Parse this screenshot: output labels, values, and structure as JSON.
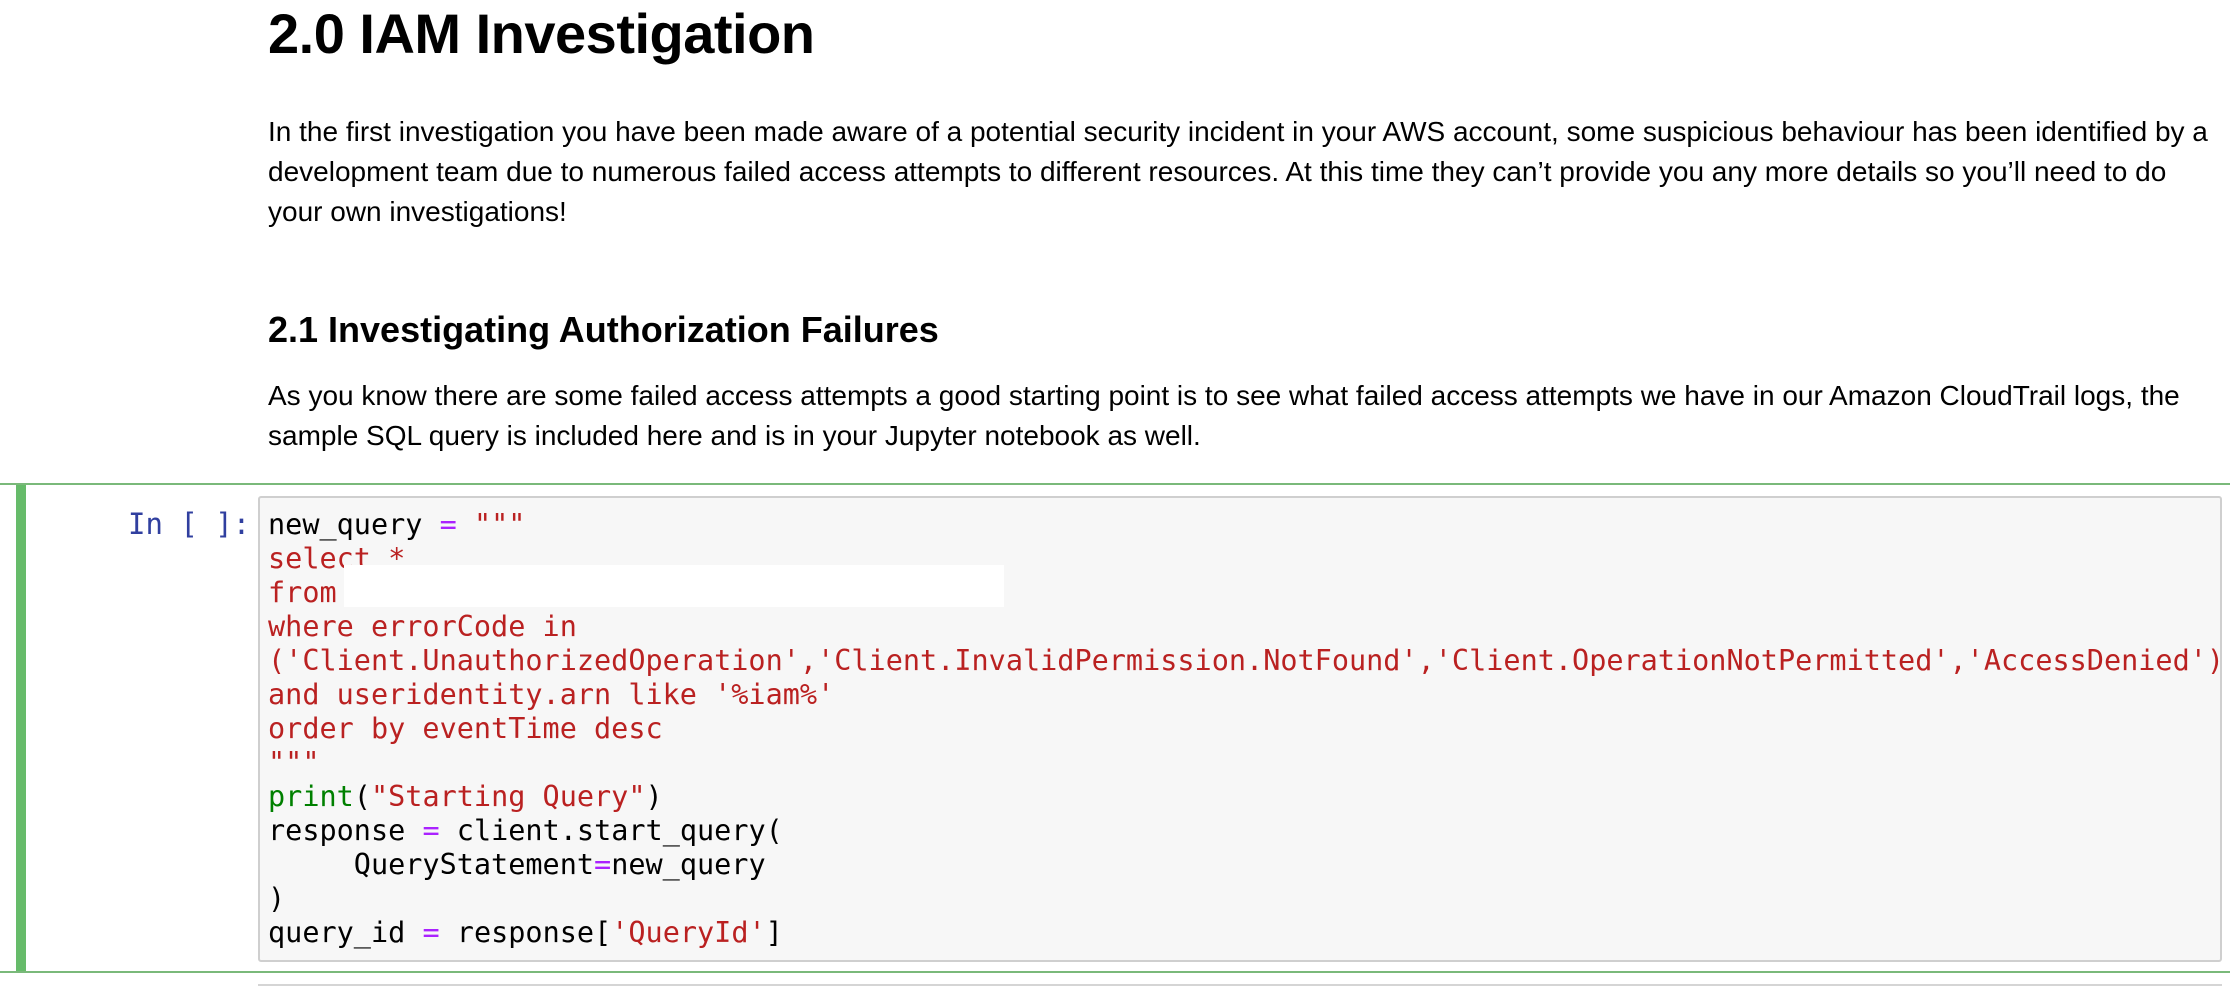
{
  "section": {
    "title": "2.0 IAM Investigation",
    "intro": "In the first investigation you have been made aware of a potential security incident in your AWS account, some suspicious behaviour has been identified by a development team due to numerous failed access attempts to different resources. At this time they can’t provide you any more details so you’ll need to do your own investigations!"
  },
  "subsection": {
    "title": "2.1 Investigating Authorization Failures",
    "body": "As you know there are some failed access attempts a good starting point is to see what failed access attempts we have in our Amazon CloudTrail logs, the sample SQL query is included here and is in your Jupyter notebook as well."
  },
  "cell": {
    "prompt": "In [ ]:",
    "lines": {
      "l1_var": "new_query",
      "l1_op": "=",
      "l1_str": "\"\"\"",
      "l2": "select *",
      "l3": "from",
      "l4": "where errorCode in",
      "l5": "('Client.UnauthorizedOperation','Client.InvalidPermission.NotFound','Client.OperationNotPermitted','AccessDenied')",
      "l6": "and useridentity.arn like '%iam%'",
      "l7": "order by eventTime desc",
      "l8": "\"\"\"",
      "l9_fn": "print",
      "l9_open": "(",
      "l9_str": "\"Starting Query\"",
      "l9_close": ")",
      "l10_a": "response",
      "l10_op": "=",
      "l10_b": "client.start_query(",
      "l11_a": "     QueryStatement",
      "l11_op": "=",
      "l11_b": "new_query",
      "l12": ")",
      "l13_a": "query_id",
      "l13_op": "=",
      "l13_b": "response[",
      "l13_str": "'QueryId'",
      "l13_c": "]"
    }
  },
  "colors": {
    "prompt": "#303f9f",
    "string": "#ba2121",
    "operator": "#aa22ff",
    "builtin": "#008000",
    "cell_selected_bar": "#66bb6a"
  }
}
